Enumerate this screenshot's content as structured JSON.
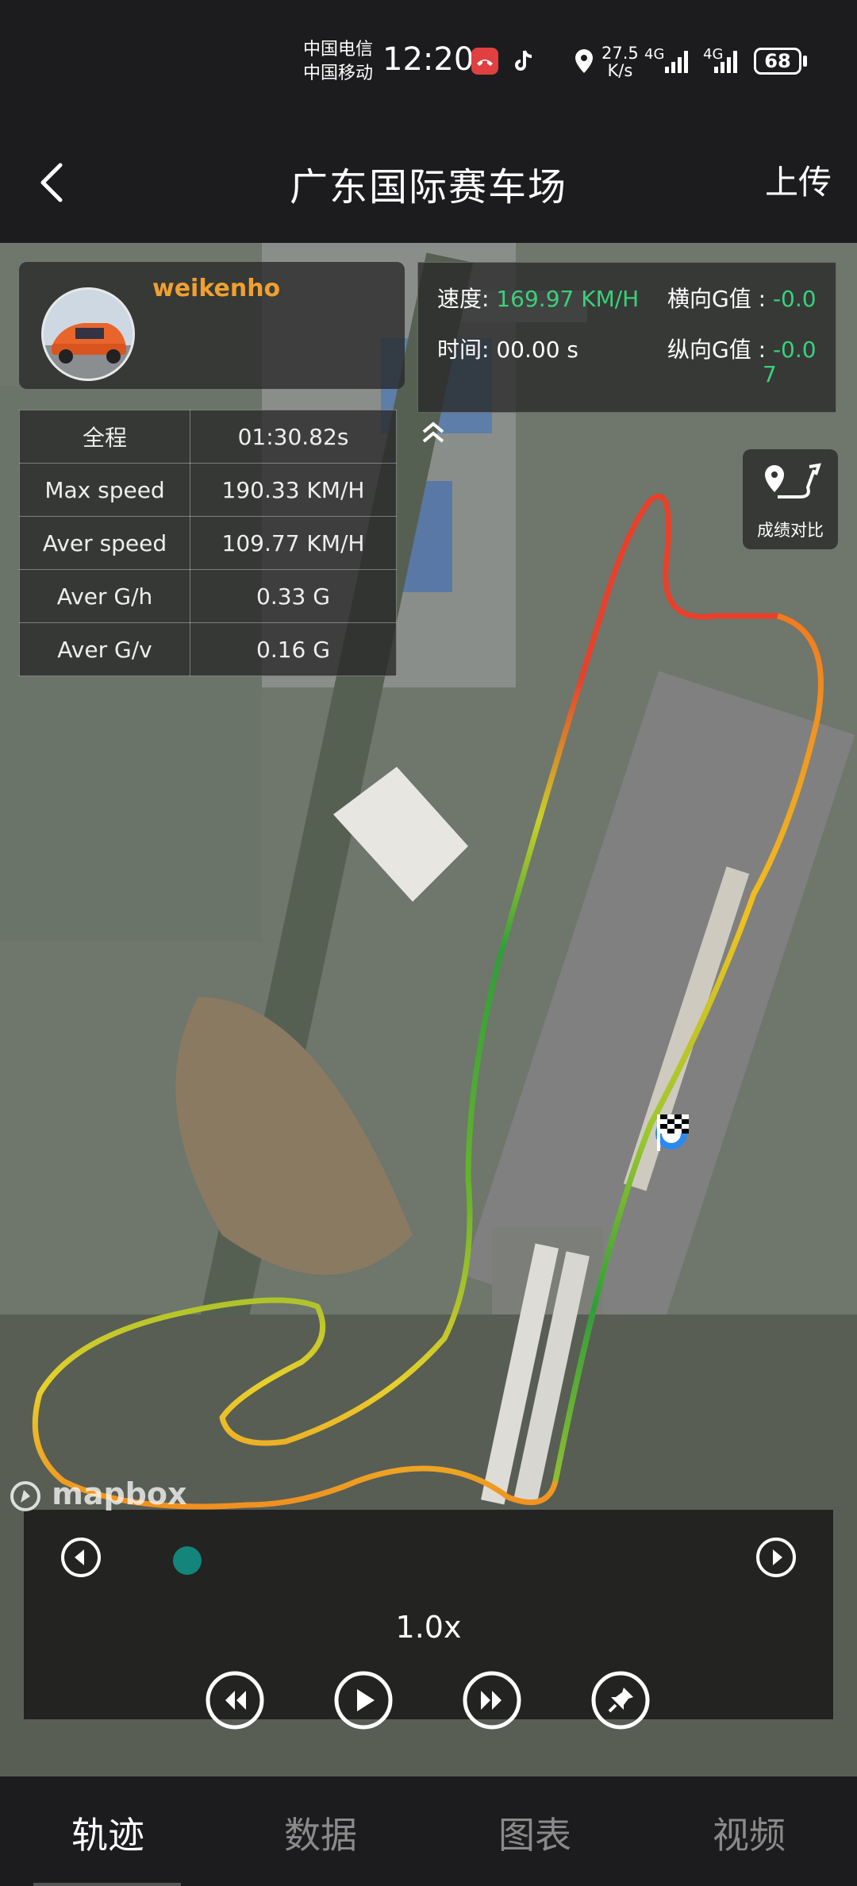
{
  "status_bar": {
    "carrier_1": "中国电信",
    "carrier_2": "中国移动",
    "time": "12:20",
    "net_speed_value": "27.5",
    "net_speed_unit": "K/s",
    "net_1": "4G",
    "net_2": "4G",
    "battery": "68"
  },
  "header": {
    "title": "广东国际赛车场",
    "upload_label": "上传"
  },
  "user": {
    "name": "weikenho"
  },
  "live": {
    "speed_label": "速度:",
    "speed_value": "169.97 KM/H",
    "time_label": "时间:",
    "time_value": "00.00 s",
    "lat_g_label": "横向G值 :",
    "lat_g_value": "-0.0",
    "lon_g_label": "纵向G值 :",
    "lon_g_value": "-0.0",
    "lon_g_value_wrap": "7"
  },
  "summary": [
    {
      "key": "全程",
      "value": "01:30.82s"
    },
    {
      "key": "Max speed",
      "value": "190.33 KM/H"
    },
    {
      "key": "Aver speed",
      "value": "109.77 KM/H"
    },
    {
      "key": "Aver G/h",
      "value": "0.33 G"
    },
    {
      "key": "Aver G/v",
      "value": "0.16 G"
    }
  ],
  "compare_label": "成绩对比",
  "player": {
    "speed": "1.0x",
    "progress": 0.02,
    "accent": "#13857a"
  },
  "attribution": "mapbox",
  "tabs": [
    {
      "label": "轨迹",
      "active": true
    },
    {
      "label": "数据",
      "active": false
    },
    {
      "label": "图表",
      "active": false
    },
    {
      "label": "视频",
      "active": false
    }
  ]
}
